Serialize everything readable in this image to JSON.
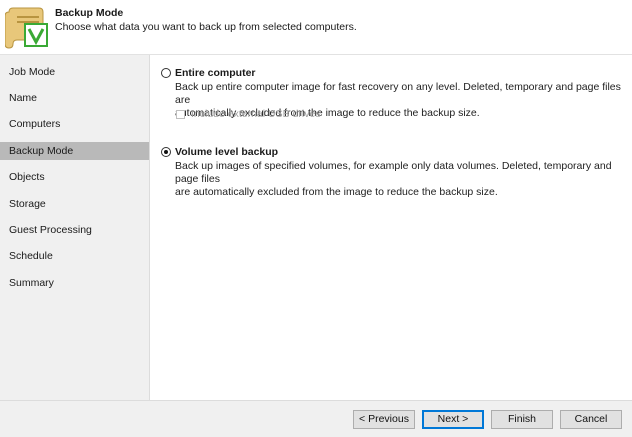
{
  "header": {
    "title": "Backup Mode",
    "subtitle": "Choose what data you want to back up from selected computers.",
    "icon": "backup-scroll-icon"
  },
  "sidebar": {
    "items": [
      {
        "label": "Job Mode",
        "selected": false
      },
      {
        "label": "Name",
        "selected": false
      },
      {
        "label": "Computers",
        "selected": false
      },
      {
        "label": "Backup Mode",
        "selected": true
      },
      {
        "label": "Objects",
        "selected": false
      },
      {
        "label": "Storage",
        "selected": false
      },
      {
        "label": "Guest Processing",
        "selected": false
      },
      {
        "label": "Schedule",
        "selected": false
      },
      {
        "label": "Summary",
        "selected": false
      }
    ]
  },
  "options": {
    "entire": {
      "label": "Entire computer",
      "desc_line1": "Back up entire computer image for fast recovery on any level. Deleted, temporary and page files are",
      "desc_line2": "automatically excluded from the image to reduce the backup size.",
      "checked": false,
      "usb_label": "Include external USB drives",
      "usb_checked": false,
      "usb_enabled": false
    },
    "volume": {
      "label": "Volume level backup",
      "desc_line1": "Back up images of specified volumes, for example only data volumes. Deleted, temporary and page files",
      "desc_line2": "are automatically excluded from the image to reduce the backup size.",
      "checked": true
    }
  },
  "footer": {
    "previous_label": "< Previous",
    "next_label": "Next >",
    "finish_label": "Finish",
    "cancel_label": "Cancel"
  },
  "colors": {
    "selected_nav": "#b9b9b9",
    "default_button_border": "#0078d7",
    "icon_check": "#3aa935"
  }
}
